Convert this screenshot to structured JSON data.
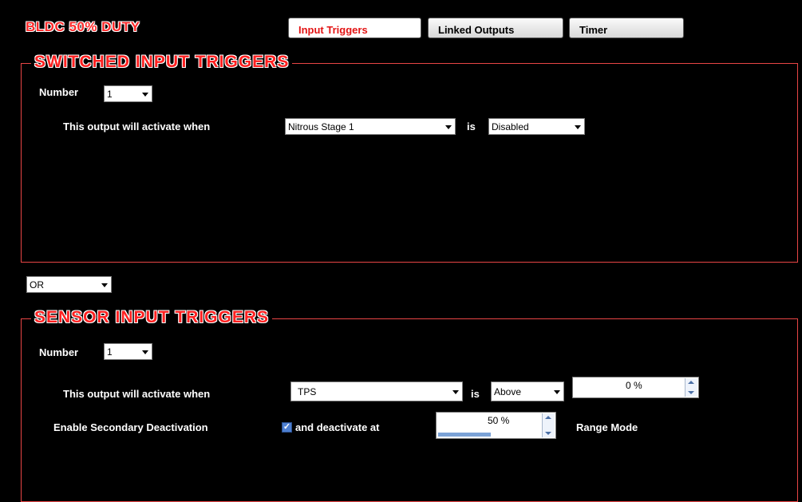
{
  "header": {
    "title": "BLDC 50% DUTY"
  },
  "tabs": [
    {
      "label": "Input Triggers",
      "active": true
    },
    {
      "label": "Linked Outputs",
      "active": false
    },
    {
      "label": "Timer",
      "active": false
    }
  ],
  "switched": {
    "title": "SWITCHED INPUT TRIGGERS",
    "number_label": "Number",
    "number_value": "1",
    "activate_label": "This output will activate when",
    "input_value": "Nitrous Stage 1",
    "is_label": "is",
    "state_value": "Disabled"
  },
  "logic": {
    "value": "OR"
  },
  "sensor": {
    "title": "SENSOR INPUT TRIGGERS",
    "number_label": "Number",
    "number_value": "1",
    "activate_label": "This output will activate when",
    "input_value": "TPS",
    "is_label": "is",
    "comparator_value": "Above",
    "threshold_value": "0 %",
    "secondary_label": "Enable Secondary Deactivation",
    "secondary_checked": true,
    "deactivate_label": "and deactivate at",
    "deactivate_value": "50 %",
    "deactivate_level_fraction": 0.5,
    "range_mode_label": "Range Mode"
  },
  "colors": {
    "accent_red": "#ff2020",
    "panel_border": "#e84545",
    "active_tab_text": "#e31414",
    "checkbox_blue": "#4d7fd1"
  },
  "icons": {
    "dropdown": "chevron-down-icon",
    "spin_up": "spin-up-icon",
    "spin_down": "spin-down-icon",
    "check": "checkmark-icon"
  }
}
